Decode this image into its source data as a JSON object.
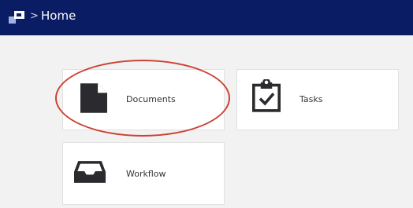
{
  "header": {
    "breadcrumb_separator": ">",
    "home_label": "Home",
    "logo_icon": "app-logo-icon"
  },
  "tiles": [
    {
      "label": "Documents",
      "icon": "document-icon"
    },
    {
      "label": "Tasks",
      "icon": "clipboard-check-icon"
    },
    {
      "label": "Workflow",
      "icon": "inbox-tray-icon"
    }
  ],
  "colors": {
    "header_bg": "#0a1c63",
    "page_bg": "#f2f2f2",
    "tile_bg": "#ffffff",
    "icon_color": "#2b2b2f",
    "highlight": "#cc4233"
  }
}
